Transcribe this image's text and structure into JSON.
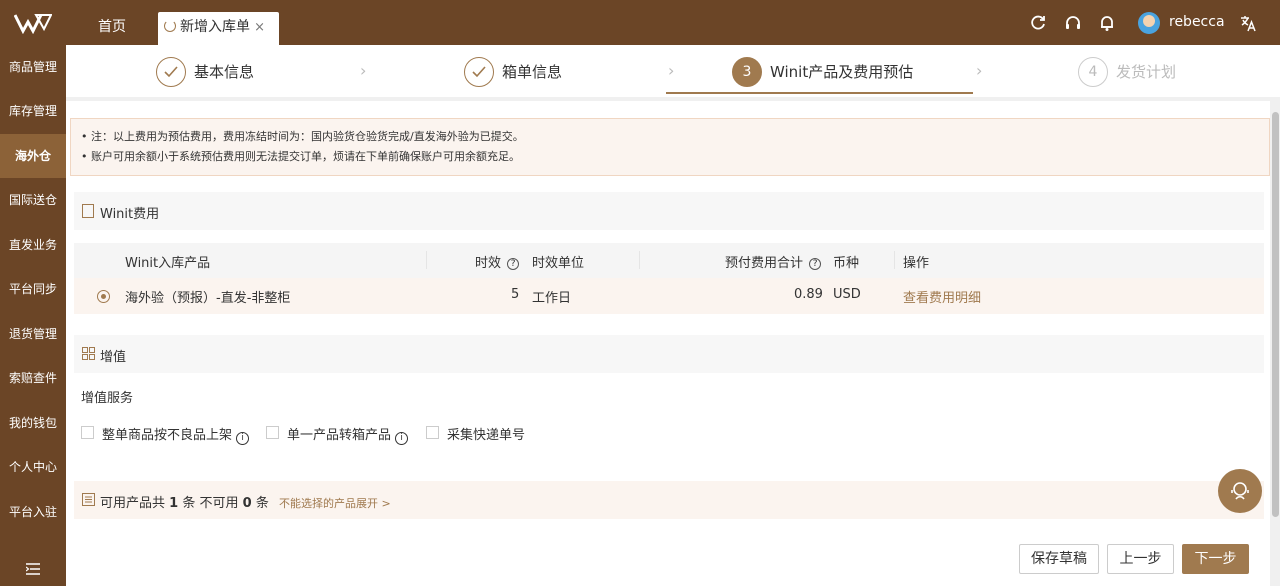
{
  "header": {
    "tabs": [
      {
        "label": "首页"
      },
      {
        "label": "新增入库单"
      }
    ],
    "close_glyph": "×",
    "username": "rebecca",
    "icons": [
      "refresh-icon",
      "headset-icon",
      "bell-icon",
      "translate-icon"
    ]
  },
  "sidebar": {
    "items": [
      {
        "label": "商品管理"
      },
      {
        "label": "库存管理"
      },
      {
        "label": "海外仓"
      },
      {
        "label": "国际送仓"
      },
      {
        "label": "直发业务"
      },
      {
        "label": "平台同步"
      },
      {
        "label": "退货管理"
      },
      {
        "label": "索赔查件"
      },
      {
        "label": "我的钱包"
      },
      {
        "label": "个人中心"
      },
      {
        "label": "平台入驻"
      }
    ],
    "active_index": 2
  },
  "steps": [
    {
      "label": "基本信息",
      "state": "done"
    },
    {
      "label": "箱单信息",
      "state": "done"
    },
    {
      "number": "3",
      "label": "Winit产品及费用预估",
      "state": "current"
    },
    {
      "number": "4",
      "label": "发货计划",
      "state": "todo"
    }
  ],
  "notice": {
    "lines": [
      "• 注：以上费用为预估费用，费用冻结时间为：国内验货仓验货完成/直发海外验为已提交。",
      "• 账户可用余额小于系统预估费用则无法提交订单，烦请在下单前确保账户可用余额充足。"
    ]
  },
  "fees": {
    "title": "Winit费用",
    "columns": {
      "product": "Winit入库产品",
      "duration": "时效",
      "unit": "时效单位",
      "total": "预付费用合计",
      "currency": "币种",
      "action": "操作"
    },
    "help_glyph": "?",
    "row": {
      "product": "海外验（预报）-直发-非整柜",
      "duration": "5",
      "unit": "工作日",
      "total": "0.89",
      "currency": "USD",
      "action": "查看费用明细"
    }
  },
  "value_added": {
    "title": "增值",
    "label": "增值服务",
    "info_glyph": "i",
    "options": [
      {
        "label": "整单商品按不良品上架",
        "has_info": true
      },
      {
        "label": "单一产品转箱产品",
        "has_info": true
      },
      {
        "label": "采集快递单号",
        "has_info": false
      }
    ]
  },
  "available": {
    "prefix": "可用产品共",
    "available_count": "1",
    "mid": "条 不可用",
    "unavailable_count": "0",
    "suffix": "条",
    "expand_link": "不能选择的产品展开 >"
  },
  "footer": {
    "save_draft": "保存草稿",
    "prev": "上一步",
    "next": "下一步"
  },
  "colors": {
    "brand": "#6b4526",
    "accent": "#a07a4f"
  }
}
